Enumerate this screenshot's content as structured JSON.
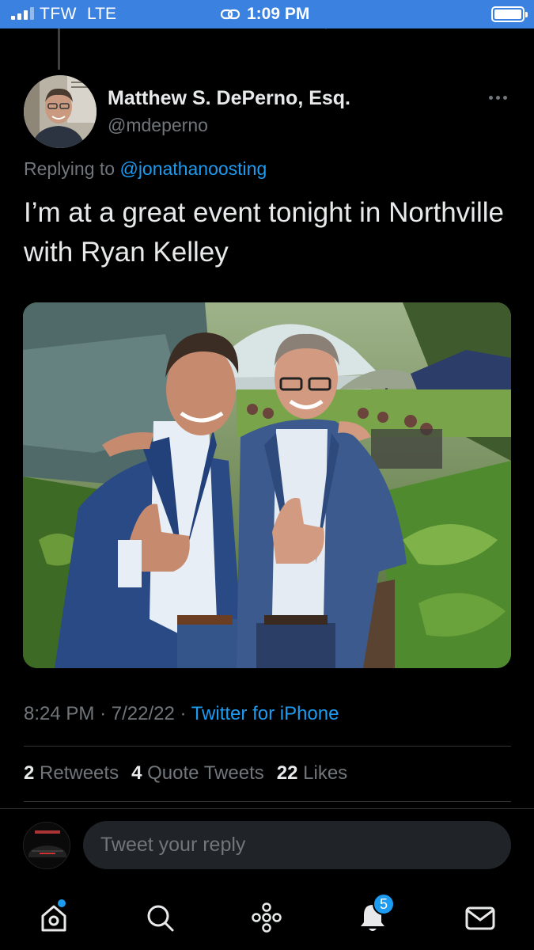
{
  "status_bar": {
    "carrier": "TFW",
    "network": "LTE",
    "time": "1:09 PM"
  },
  "tweet": {
    "display_name": "Matthew S. DePerno, Esq.",
    "handle": "@mdeperno",
    "replying_prefix": "Replying to",
    "replying_to": "@jonathanoosting",
    "text": "I’m at a great event tonight in Northville with Ryan Kelley",
    "time": "8:24 PM",
    "date": "7/22/22",
    "source": "Twitter for iPhone",
    "separator": "·"
  },
  "stats": {
    "retweets_count": "2",
    "retweets_label": "Retweets",
    "quotes_count": "4",
    "quotes_label": "Quote Tweets",
    "likes_count": "22",
    "likes_label": "Likes"
  },
  "reply": {
    "placeholder": "Tweet your reply"
  },
  "tab_bar": {
    "notifications_badge": "5"
  },
  "colors": {
    "accent": "#1d9bf0",
    "status_bar": "#3b82e0",
    "background": "#000000",
    "muted": "#71767b"
  }
}
